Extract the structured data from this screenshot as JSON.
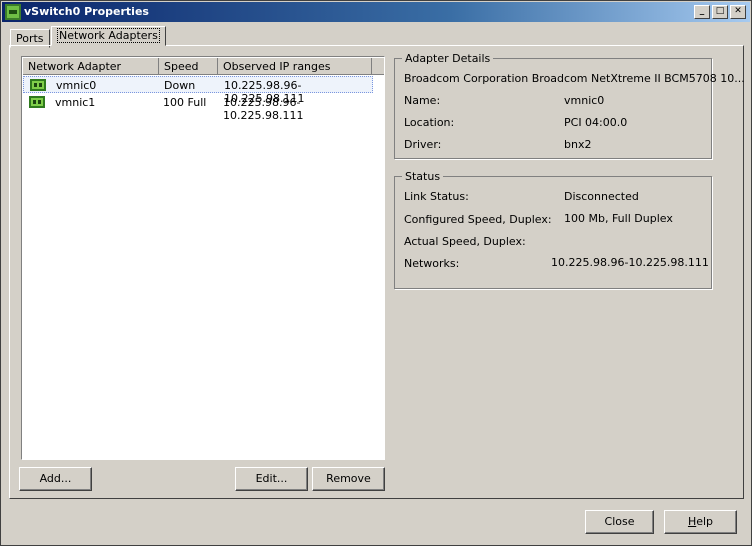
{
  "window": {
    "title": "vSwitch0 Properties"
  },
  "title_buttons": {
    "minimize": "_",
    "maximize": "□",
    "close": "✕"
  },
  "tabs": [
    {
      "label": "Ports"
    },
    {
      "label": "Network Adapters"
    }
  ],
  "adapters_table": {
    "columns": [
      "Network Adapter",
      "Speed",
      "Observed IP ranges"
    ],
    "rows": [
      {
        "name": "vmnic0",
        "speed": "Down",
        "ip_ranges": "10.225.98.96-10.225.98.111",
        "selected": true
      },
      {
        "name": "vmnic1",
        "speed": "100 Full",
        "ip_ranges": "10.225.98.96-10.225.98.111",
        "selected": false
      }
    ]
  },
  "list_buttons": {
    "add": "Add...",
    "edit": "Edit...",
    "remove": "Remove"
  },
  "adapter_details": {
    "group_label": "Adapter Details",
    "description": "Broadcom Corporation Broadcom NetXtreme II BCM5708 10...",
    "fields": [
      {
        "label": "Name:",
        "value": "vmnic0"
      },
      {
        "label": "Location:",
        "value": "PCI 04:00.0"
      },
      {
        "label": "Driver:",
        "value": "bnx2"
      }
    ]
  },
  "status": {
    "group_label": "Status",
    "fields": [
      {
        "label": "Link Status:",
        "value": "Disconnected"
      },
      {
        "label": "Configured Speed, Duplex:",
        "value": "100 Mb, Full Duplex"
      },
      {
        "label": "Actual Speed, Duplex:",
        "value": ""
      },
      {
        "label": "Networks:",
        "value": "10.225.98.96-10.225.98.111"
      }
    ]
  },
  "dialog_buttons": {
    "close": "Close",
    "help_prefix": "",
    "help_hotkey": "H",
    "help_rest": "elp"
  },
  "icons": {
    "title_icon": "vsphere-network-icon",
    "adapter_icon": "network-card-icon"
  }
}
